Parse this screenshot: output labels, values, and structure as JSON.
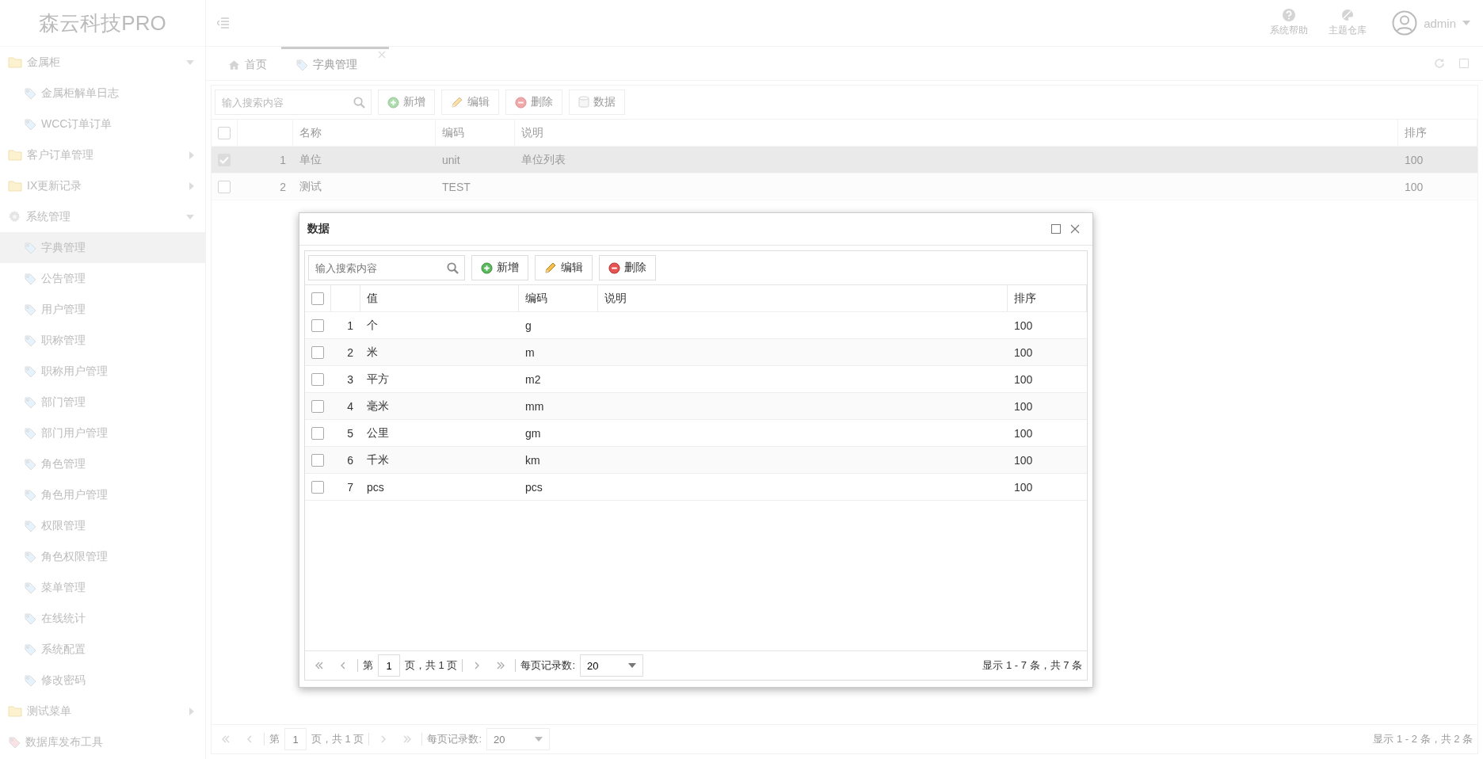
{
  "sidebar": {
    "logo": "森云科技PRO",
    "items": [
      {
        "kind": "folder",
        "label": "金属柜",
        "expanded": true,
        "selected": false
      },
      {
        "kind": "leaf",
        "label": "金属柜解单日志",
        "selected": false
      },
      {
        "kind": "leaf",
        "label": "WCC订单订单",
        "selected": false
      },
      {
        "kind": "folder",
        "label": "客户订单管理",
        "expanded": false,
        "selected": false
      },
      {
        "kind": "folder",
        "label": "IX更新记录",
        "expanded": false,
        "selected": false
      },
      {
        "kind": "settings",
        "label": "系统管理",
        "expanded": true,
        "selected": false
      },
      {
        "kind": "leaf",
        "label": "字典管理",
        "selected": true
      },
      {
        "kind": "leaf",
        "label": "公告管理",
        "selected": false
      },
      {
        "kind": "leaf",
        "label": "用户管理",
        "selected": false
      },
      {
        "kind": "leaf",
        "label": "职称管理",
        "selected": false
      },
      {
        "kind": "leaf",
        "label": "职称用户管理",
        "selected": false
      },
      {
        "kind": "leaf",
        "label": "部门管理",
        "selected": false
      },
      {
        "kind": "leaf",
        "label": "部门用户管理",
        "selected": false
      },
      {
        "kind": "leaf",
        "label": "角色管理",
        "selected": false
      },
      {
        "kind": "leaf",
        "label": "角色用户管理",
        "selected": false
      },
      {
        "kind": "leaf",
        "label": "权限管理",
        "selected": false
      },
      {
        "kind": "leaf",
        "label": "角色权限管理",
        "selected": false
      },
      {
        "kind": "leaf",
        "label": "菜单管理",
        "selected": false
      },
      {
        "kind": "leaf",
        "label": "在线统计",
        "selected": false
      },
      {
        "kind": "leaf",
        "label": "系统配置",
        "selected": false
      },
      {
        "kind": "leaf",
        "label": "修改密码",
        "selected": false
      },
      {
        "kind": "folder",
        "label": "测试菜单",
        "expanded": false,
        "selected": false
      },
      {
        "kind": "tool",
        "label": "数据库发布工具",
        "selected": false
      }
    ]
  },
  "header": {
    "actions": [
      {
        "kind": "help",
        "label": "系统帮助"
      },
      {
        "kind": "theme",
        "label": "主题仓库"
      }
    ],
    "user": "admin"
  },
  "tabs": [
    {
      "kind": "home",
      "label": "首页",
      "selected": false,
      "closable": false
    },
    {
      "kind": "tag",
      "label": "字典管理",
      "selected": true,
      "closable": true
    }
  ],
  "toolbar": {
    "search_placeholder": "输入搜索内容",
    "buttons": [
      {
        "kind": "add",
        "label": "新增"
      },
      {
        "kind": "edit",
        "label": "编辑"
      },
      {
        "kind": "delete",
        "label": "删除"
      },
      {
        "kind": "data",
        "label": "数据"
      }
    ]
  },
  "table": {
    "all_checked": false,
    "columns": [
      "名称",
      "编码",
      "说明",
      "排序"
    ],
    "rows": [
      {
        "index": "1",
        "cells": [
          "单位",
          "unit",
          "单位列表",
          "100"
        ],
        "checked": true,
        "selected": true
      },
      {
        "index": "2",
        "cells": [
          "测试",
          "TEST",
          "",
          "100"
        ],
        "checked": false,
        "selected": false
      }
    ]
  },
  "pager": {
    "page_prefix": "第",
    "page": "1",
    "page_suffix": "页，共 1 页",
    "page_size_label": "每页记录数:",
    "page_size": "20",
    "summary": "显示 1 - 2 条，共 2 条"
  },
  "dialog": {
    "title": "数据",
    "toolbar": {
      "search_placeholder": "输入搜索内容",
      "buttons": [
        {
          "kind": "add",
          "label": "新增"
        },
        {
          "kind": "edit",
          "label": "编辑"
        },
        {
          "kind": "delete",
          "label": "删除"
        }
      ]
    },
    "table": {
      "all_checked": false,
      "columns": [
        "值",
        "编码",
        "说明",
        "排序"
      ],
      "rows": [
        {
          "index": "1",
          "cells": [
            "个",
            "g",
            "",
            "100"
          ],
          "checked": false,
          "selected": false
        },
        {
          "index": "2",
          "cells": [
            "米",
            "m",
            "",
            "100"
          ],
          "checked": false,
          "selected": false
        },
        {
          "index": "3",
          "cells": [
            "平方",
            "m2",
            "",
            "100"
          ],
          "checked": false,
          "selected": false
        },
        {
          "index": "4",
          "cells": [
            "毫米",
            "mm",
            "",
            "100"
          ],
          "checked": false,
          "selected": false
        },
        {
          "index": "5",
          "cells": [
            "公里",
            "gm",
            "",
            "100"
          ],
          "checked": false,
          "selected": false
        },
        {
          "index": "6",
          "cells": [
            "千米",
            "km",
            "",
            "100"
          ],
          "checked": false,
          "selected": false
        },
        {
          "index": "7",
          "cells": [
            "pcs",
            "pcs",
            "",
            "100"
          ],
          "checked": false,
          "selected": false
        }
      ]
    },
    "pager": {
      "page_prefix": "第",
      "page": "1",
      "page_suffix": "页，共 1 页",
      "page_size_label": "每页记录数:",
      "page_size": "20",
      "summary": "显示 1 - 7 条，共 7 条"
    }
  }
}
